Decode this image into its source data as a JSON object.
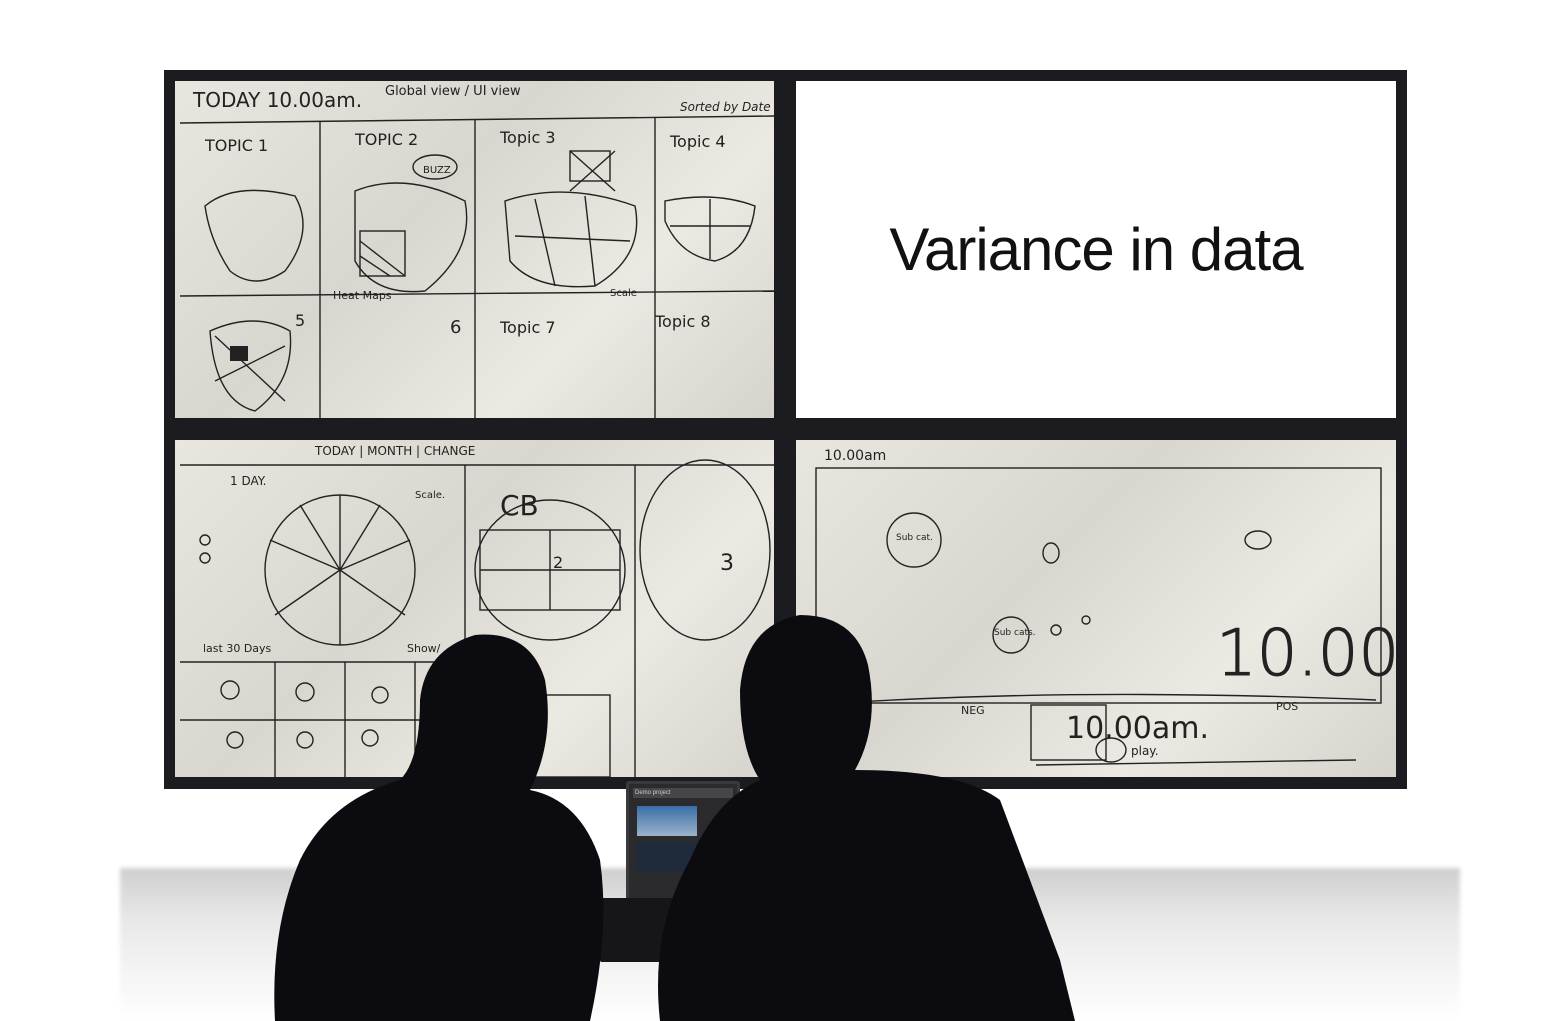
{
  "slide_title": "Variance in data",
  "sketch1": {
    "header": "TODAY 10.00am.",
    "header_right": "Global view / UI view",
    "note_top_right": "Sorted by Date",
    "topics": [
      "TOPIC 1",
      "TOPIC 2",
      "Topic 3",
      "Topic 4"
    ],
    "buzz": "BUZZ",
    "heat_maps": "Heat Maps",
    "scale": "Scale",
    "row2": [
      "5",
      "6",
      "Topic 7",
      "Topic 8"
    ]
  },
  "sketch2": {
    "header": "TODAY | MONTH | CHANGE",
    "day": "1 DAY.",
    "scale": "Scale.",
    "cb": "CB",
    "two": "2",
    "three": "3",
    "last30": "last 30 Days",
    "show": "Show/"
  },
  "sketch3": {
    "time": "10.00am",
    "sub_cat": "Sub cat.",
    "sub_cats": "Sub cats.",
    "big_time": "10.00",
    "neg": "NEG",
    "pos": "POS",
    "clock": "10.00am.",
    "play": "play."
  },
  "laptop": {
    "tab": "Demo project"
  }
}
